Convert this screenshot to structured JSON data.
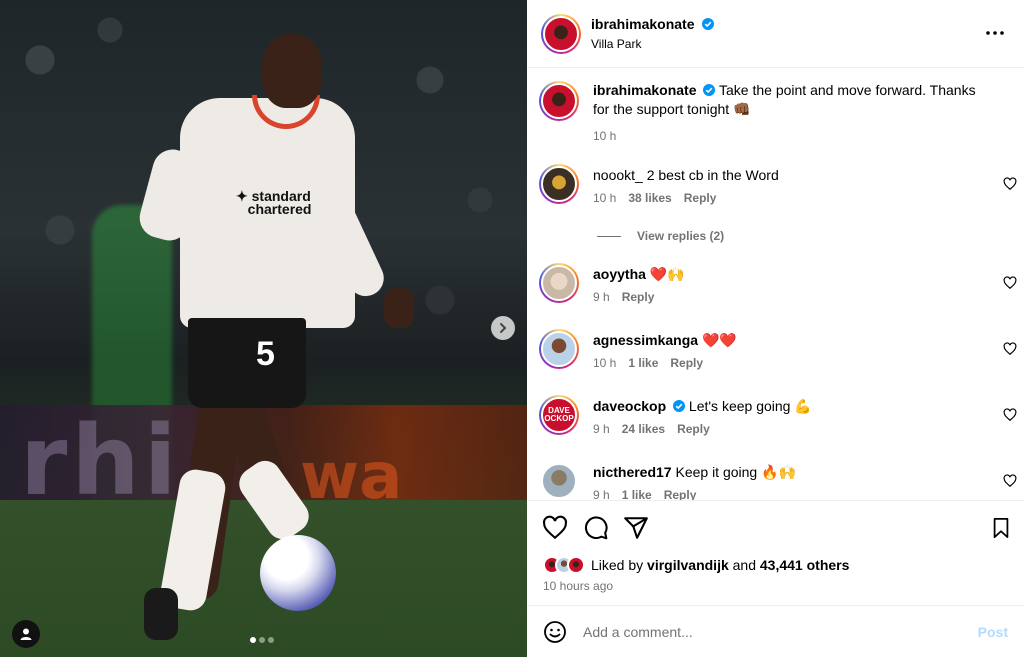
{
  "post": {
    "author": "ibrahimakonate",
    "location": "Villa Park",
    "caption_author": "ibrahimakonate",
    "caption": "Take the point and move forward. Thanks for the support tonight 👊🏾",
    "caption_time": "10 h"
  },
  "media": {
    "sponsor_text": "Standard Chartered",
    "shirt_number": "5",
    "carousel_count": 3,
    "carousel_active": 0
  },
  "comments": [
    {
      "user": "noookt_",
      "text": "2 best cb in the Word",
      "time": "10 h",
      "likes": "38 likes",
      "reply": "Reply",
      "verified": false
    },
    {
      "user": "aoyytha",
      "text": "❤️🙌",
      "time": "9 h",
      "likes": "",
      "reply": "Reply",
      "verified": false
    },
    {
      "user": "agnessimkanga",
      "text": "❤️❤️",
      "time": "10 h",
      "likes": "1 like",
      "reply": "Reply",
      "verified": false
    },
    {
      "user": "daveockop",
      "text": "Let's keep going 💪",
      "time": "9 h",
      "likes": "24 likes",
      "reply": "Reply",
      "verified": true,
      "avatar_text": "DAVE OCKOP"
    },
    {
      "user": "nicthered17",
      "text": "Keep it going 🔥🙌",
      "time": "9 h",
      "likes": "1 like",
      "reply": "Reply",
      "verified": false
    }
  ],
  "view_replies": "View replies (2)",
  "likes": {
    "prefix": "Liked by",
    "user": "virgilvandijk",
    "conjunction": "and",
    "others": "43,441 others"
  },
  "time_ago": "10 hours ago",
  "add_comment": {
    "placeholder": "Add a comment...",
    "post_label": "Post"
  },
  "colors": {
    "link_blue": "#0095f6",
    "muted": "#737373",
    "post_disabled": "#b3dbff",
    "verified": "#0095f6"
  }
}
